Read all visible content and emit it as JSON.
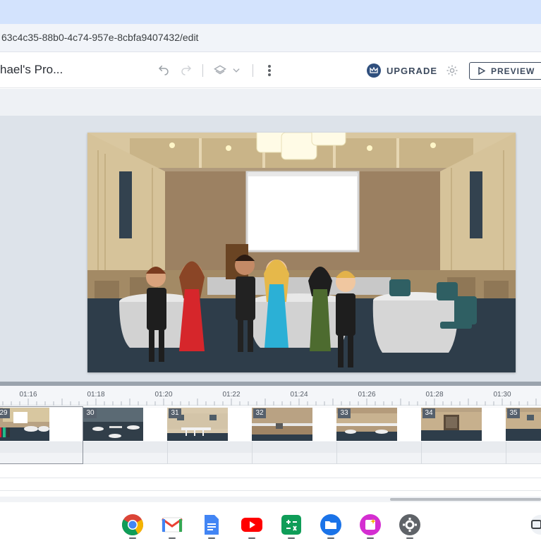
{
  "browser": {
    "url": "63c4c35-88b0-4c74-957e-8cbfa9407432/edit"
  },
  "header": {
    "project_title": "hael's Pro...",
    "upgrade_label": "UPGRADE",
    "preview_label": "PREVIEW"
  },
  "timeline": {
    "time_labels": [
      "01:16",
      "01:18",
      "01:20",
      "01:22",
      "01:24",
      "01:26",
      "01:28",
      "01:30"
    ],
    "scenes": [
      {
        "number": "29",
        "thumb": "ballroom-crowd"
      },
      {
        "number": "30",
        "thumb": "hall-tables"
      },
      {
        "number": "31",
        "thumb": "room-bar"
      },
      {
        "number": "32",
        "thumb": "room-podium"
      },
      {
        "number": "33",
        "thumb": "room-tables"
      },
      {
        "number": "34",
        "thumb": "room-door"
      },
      {
        "number": "35",
        "thumb": "room-plain"
      }
    ]
  },
  "shelf": {
    "apps": [
      "chrome-icon",
      "gmail-icon",
      "docs-icon",
      "youtube-icon",
      "sheets-icon",
      "files-icon",
      "canvas-icon",
      "settings-icon"
    ]
  },
  "colors": {
    "accent": "#2f4f7d",
    "tabstrip": "#d3e3fd",
    "stage_bg": "#dde3ea"
  }
}
